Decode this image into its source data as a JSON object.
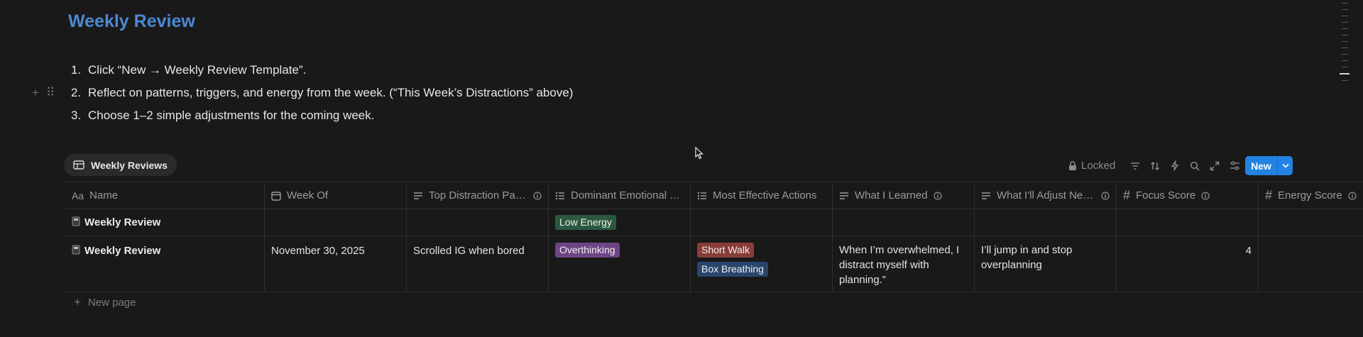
{
  "page": {
    "title": "Weekly Review",
    "steps": [
      {
        "num": "1.",
        "text": "Click “New → Weekly Review Template”."
      },
      {
        "num": "2.",
        "text": "Reflect on patterns, triggers, and energy from the week. (“This Week’s Distractions” above)"
      },
      {
        "num": "3.",
        "text": "Choose 1–2 simple adjustments for the coming week."
      }
    ]
  },
  "view": {
    "tab_label": "Weekly Reviews"
  },
  "toolbar": {
    "locked_label": "Locked",
    "new_label": "New",
    "icons": [
      "filter-icon",
      "sort-icon",
      "automation-icon",
      "search-icon",
      "expand-icon",
      "settings-icon"
    ]
  },
  "table": {
    "columns": [
      {
        "label": "Name",
        "icon": "title-icon"
      },
      {
        "label": "Week Of",
        "icon": "calendar-icon"
      },
      {
        "label": "Top Distraction Patt...",
        "icon": "text-icon",
        "info": true
      },
      {
        "label": "Dominant Emotional Tr...",
        "icon": "multiselect-icon"
      },
      {
        "label": "Most Effective Actions",
        "icon": "multiselect-icon"
      },
      {
        "label": "What I Learned",
        "icon": "text-icon",
        "info": true
      },
      {
        "label": "What I'll Adjust Next...",
        "icon": "text-icon",
        "info": true
      },
      {
        "label": "Focus Score",
        "icon": "number-icon",
        "info": true
      },
      {
        "label": "Energy Score",
        "icon": "number-icon",
        "info": true
      }
    ],
    "rows": [
      {
        "name": "Weekly Review",
        "week_of": "",
        "top_distraction": "",
        "emotional_tags": [
          {
            "label": "Low Energy",
            "color": "#2b593f"
          }
        ],
        "actions": [],
        "learned": "",
        "adjust": "",
        "focus": "",
        "energy": ""
      },
      {
        "name": "Weekly Review",
        "week_of": "November 30, 2025",
        "top_distraction": "Scrolled IG when bored",
        "emotional_tags": [
          {
            "label": "Overthinking",
            "color": "#6d4584"
          }
        ],
        "actions": [
          {
            "label": "Short Walk",
            "color": "#8a3c38"
          },
          {
            "label": "Box Breathing",
            "color": "#28456c"
          }
        ],
        "learned": "When I’m overwhelmed, I distract myself with planning.”",
        "adjust": "I’ll jump in and stop overplanning",
        "focus": "4",
        "energy": ""
      }
    ],
    "new_page_label": "New page"
  },
  "colors": {
    "background": "#191919",
    "title": "#4c88d3",
    "accent": "#2383e2"
  }
}
